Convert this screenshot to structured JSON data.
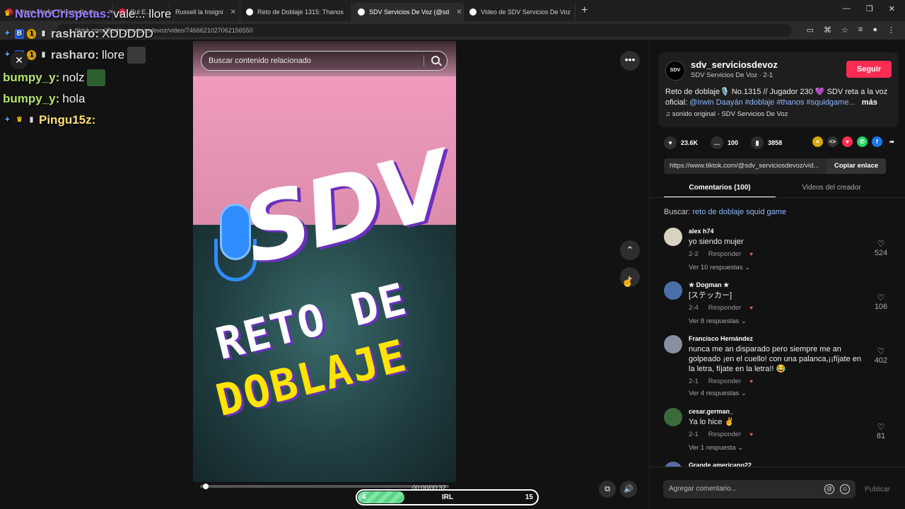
{
  "browser": {
    "tabs": [
      {
        "label": "Ultima Media: Primer día de..."
      },
      {
        "label": "Cul E..."
      },
      {
        "label": "Russell la Insigni"
      },
      {
        "label": "Reto de Doblaje 1315: Thanos"
      },
      {
        "label": "SDV Servicios De Voz (@sd"
      },
      {
        "label": "Video de SDV Servicios De Voz"
      }
    ],
    "new_tab": "+",
    "window_controls": [
      "—",
      "❐",
      "✕"
    ],
    "url": "tiktok.com/@sdv_serviciosdevoz/video/7466621027062156550"
  },
  "chat": [
    {
      "user": "NachoCrispetas:",
      "msg": "vale... llore",
      "user_color": "#9b7bff"
    },
    {
      "user": "rasharo:",
      "msg": "XDDDDD",
      "user_color": "#d0d0d0"
    },
    {
      "user": "rasharo:",
      "msg": "llore",
      "user_color": "#d0d0d0"
    },
    {
      "user": "bumpy_y:",
      "msg": "nolz",
      "user_color": "#b6e36b"
    },
    {
      "user": "bumpy_y:",
      "msg": "hola",
      "user_color": "#b6e36b"
    },
    {
      "user": "Pingu15z:",
      "msg": "",
      "user_color": "#ffe06b"
    }
  ],
  "video": {
    "search_placeholder": "Buscar contenido relacionado",
    "overlay_sdv": "SDV",
    "overlay_reto": "RETO DE",
    "overlay_doblaje": "DOBLAJE",
    "timecode": "00:00/00:32",
    "irl_left": "4",
    "irl_mid": "IRL",
    "irl_right": "15",
    "progress": 0.01
  },
  "panel": {
    "username": "sdv_serviciosdevoz",
    "subname": "SDV Servicios De Voz · 2-1",
    "avatar": "SDV",
    "follow": "Seguir",
    "desc_plain": "Reto de doblaje🎙️ No.1315 // Jugador 230 💜 SDV reta a la voz oficial: ",
    "desc_tags": "@Irwin Daayán #doblaje #thanos #squidgame...",
    "desc_more": "más",
    "sound": "♫  sonido original - SDV Servicios De Voz",
    "likes": "23.6K",
    "comments_count": "100",
    "saves": "3858",
    "link": "https://www.tiktok.com/@sdv_serviciosdevoz/vid...",
    "copy_link": "Copiar enlace",
    "tab_comments": "Comentarios (100)",
    "tab_creator": "Videos del creador",
    "search_label": "Buscar: ",
    "search_query": "reto de doblaje squid game",
    "comments": [
      {
        "user": "alex h74",
        "text": "yo siendo mujer",
        "date": "2-2",
        "reply": "Responder",
        "replies": "Ver 10 respuestas ⌄",
        "likes": "524"
      },
      {
        "user": "★ Dogman ★",
        "text": "[ステッカー]",
        "date": "2-4",
        "reply": "Responder",
        "replies": "Ver 8 respuestas ⌄",
        "likes": "106"
      },
      {
        "user": "Francisco Hernández",
        "text": "nunca me an disparado pero siempre me an golpeado ¡en el cuello! con una palanca,¡¡fíjate en la letra, fíjate en la letra!! 😂",
        "date": "2-1",
        "reply": "Responder",
        "replies": "Ver 4 respuestas ⌄",
        "likes": "402"
      },
      {
        "user": "cesar.german_",
        "text": "Ya lo hice ✌️",
        "date": "2-1",
        "reply": "Responder",
        "replies": "Ver 1 respuesta ⌄",
        "likes": "81"
      },
      {
        "user": "Grande americano22",
        "text": "",
        "date": "",
        "reply": "",
        "replies": "",
        "likes": ""
      }
    ],
    "add_comment": "Agregar comentario...",
    "publish": "Publicar"
  }
}
